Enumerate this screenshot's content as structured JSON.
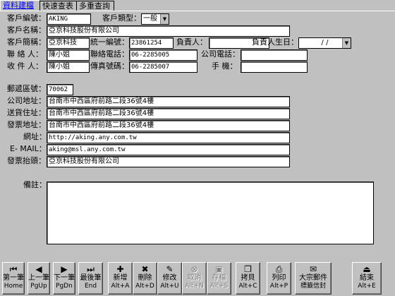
{
  "tabs": [
    "資料建檔",
    "快速查表",
    "多重查詢"
  ],
  "form": {
    "customer_no_label": "客戶編號：",
    "customer_no": "AKING",
    "customer_type_label": "客戶類型：",
    "customer_type": "一般",
    "customer_name_label": "客戶名稱：",
    "customer_name": "亞京科技股份有限公司",
    "short_name_label": "客戶簡稱：",
    "short_name": "亞京科技",
    "tax_id_label": "統一編號：",
    "tax_id": "23861254",
    "owner_label": "負責人：",
    "owner": "",
    "owner_birthday_label": "負責人生日：",
    "owner_birthday": "/ /",
    "contact_label": "聯 絡 人：",
    "contact": "陳小姐",
    "contact_phone_label": "聯絡電話：",
    "contact_phone": "06-2285005",
    "company_phone_label": "公司電話：",
    "company_phone": "",
    "recipient_label": "收 件 人：",
    "recipient": "陳小姐",
    "fax_label": "傳真號碼：",
    "fax": "06-2285007",
    "mobile_label": "手 機：",
    "mobile": "",
    "zip_label": "郵遞區號：",
    "zip": "70062",
    "company_addr_label": "公司地址：",
    "company_addr": "台南市中西區府前路二段36號4樓",
    "shipping_addr_label": "送貨住址：",
    "shipping_addr": "台南市中西區府前路二段36號4樓",
    "invoice_addr_label": "發票地址：",
    "invoice_addr": "台南市中西區府前路二段36號4樓",
    "website_label": "網址：",
    "website": "http://aking.any.com.tw",
    "email_label": "E- MAIL：",
    "email": "aking@msl.any.com.tw",
    "invoice_title_label": "發票抬頭：",
    "invoice_title": "亞京科技股份有限公司",
    "notes_label": "備註：",
    "notes": ""
  },
  "toolbar": [
    {
      "name": "first-record-button",
      "icon": "first-record-icon",
      "glyph": "⏮",
      "line1": "第一筆",
      "line2": "Home",
      "enabled": true
    },
    {
      "name": "prev-record-button",
      "icon": "prev-record-icon",
      "glyph": "◀",
      "line1": "上一筆",
      "line2": "PgUp",
      "enabled": true
    },
    {
      "name": "next-record-button",
      "icon": "next-record-icon",
      "glyph": "▶",
      "line1": "下一筆",
      "line2": "PgDn",
      "enabled": true
    },
    {
      "name": "last-record-button",
      "icon": "last-record-icon",
      "glyph": "⏭",
      "line1": "最後筆",
      "line2": "End",
      "enabled": true
    },
    {
      "name": "add-button",
      "icon": "add-icon",
      "glyph": "✚",
      "line1": "新增",
      "line2": "Alt+A",
      "enabled": true
    },
    {
      "name": "delete-button",
      "icon": "delete-icon",
      "glyph": "✖",
      "line1": "刪除",
      "line2": "Alt+D",
      "enabled": true
    },
    {
      "name": "edit-button",
      "icon": "edit-icon",
      "glyph": "✎",
      "line1": "修改",
      "line2": "Alt+U",
      "enabled": true
    },
    {
      "name": "cancel-button",
      "icon": "cancel-icon",
      "glyph": "⊗",
      "line1": "取消",
      "line2": "Alt+N",
      "enabled": false
    },
    {
      "name": "save-button",
      "icon": "save-icon",
      "glyph": "▣",
      "line1": "存檔",
      "line2": "Alt+S",
      "enabled": false
    },
    {
      "name": "copy-button",
      "icon": "copy-icon",
      "glyph": "❐",
      "line1": "拷貝",
      "line2": "Alt+C",
      "enabled": true
    },
    {
      "name": "print-button",
      "icon": "print-icon",
      "glyph": "⎙",
      "line1": "列印",
      "line2": "Alt+P",
      "enabled": true
    },
    {
      "name": "mailing-label-button",
      "icon": "envelope-icon",
      "glyph": "✉",
      "line1": "大宗郵件",
      "line2": "標籤信封",
      "enabled": true
    },
    {
      "name": "exit-button",
      "icon": "exit-icon",
      "glyph": "⏏",
      "line1": "結束",
      "line2": "Alt+E",
      "enabled": true
    }
  ]
}
